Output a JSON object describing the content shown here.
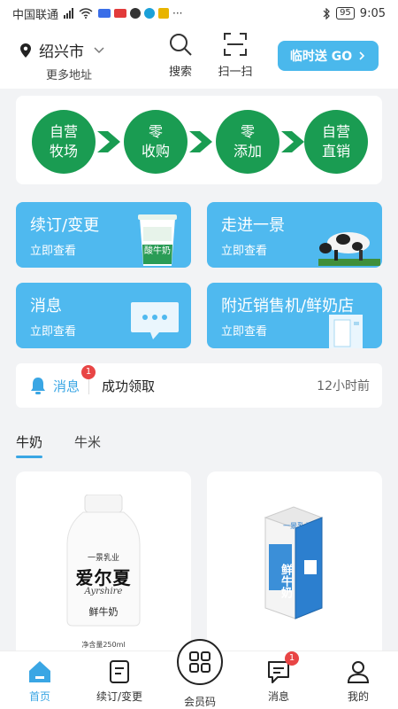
{
  "status_bar": {
    "carrier": "中国联通",
    "battery": "95",
    "time": "9:05"
  },
  "header": {
    "city": "绍兴市",
    "more_address": "更多地址",
    "search_label": "搜索",
    "scan_label": "扫一扫",
    "cta_label": "临时送 GO",
    "cta_color": "#4ab8ec"
  },
  "process": {
    "steps": [
      {
        "line1": "自营",
        "line2": "牧场"
      },
      {
        "line1": "零",
        "line2": "收购"
      },
      {
        "line1": "零",
        "line2": "添加"
      },
      {
        "line1": "自营",
        "line2": "直销"
      }
    ],
    "accent": "#1a9c52"
  },
  "cards": [
    {
      "title": "续订/变更",
      "subtitle": "立即查看",
      "product_label": "酸牛奶",
      "icon": "yogurt-cup-icon"
    },
    {
      "title": "走进一景",
      "subtitle": "立即查看",
      "icon": "cow-icon"
    },
    {
      "title": "消息",
      "subtitle": "立即查看",
      "icon": "chat-bubble-icon"
    },
    {
      "title": "附近销售机/鲜奶店",
      "subtitle": "立即查看",
      "icon": "vending-machine-icon"
    }
  ],
  "message_bar": {
    "label": "消息",
    "badge": "1",
    "content": "成功领取",
    "time": "12小时前"
  },
  "tabs": [
    {
      "label": "牛奶",
      "active": true
    },
    {
      "label": "牛米",
      "active": false
    }
  ],
  "products": [
    {
      "brand": "一景乳业",
      "name": "爱尔夏",
      "name_en": "Ayrshire",
      "type": "鲜牛奶",
      "volume": "净含量250ml"
    },
    {
      "brand": "一景乳业",
      "name": "鲜牛奶"
    }
  ],
  "bottom_nav": {
    "items": [
      {
        "label": "首页",
        "active": true
      },
      {
        "label": "续订/变更",
        "active": false
      },
      {
        "label": "会员码",
        "active": false
      },
      {
        "label": "消息",
        "active": false,
        "badge": "1"
      },
      {
        "label": "我的",
        "active": false
      }
    ],
    "active_color": "#3aa6e4"
  }
}
